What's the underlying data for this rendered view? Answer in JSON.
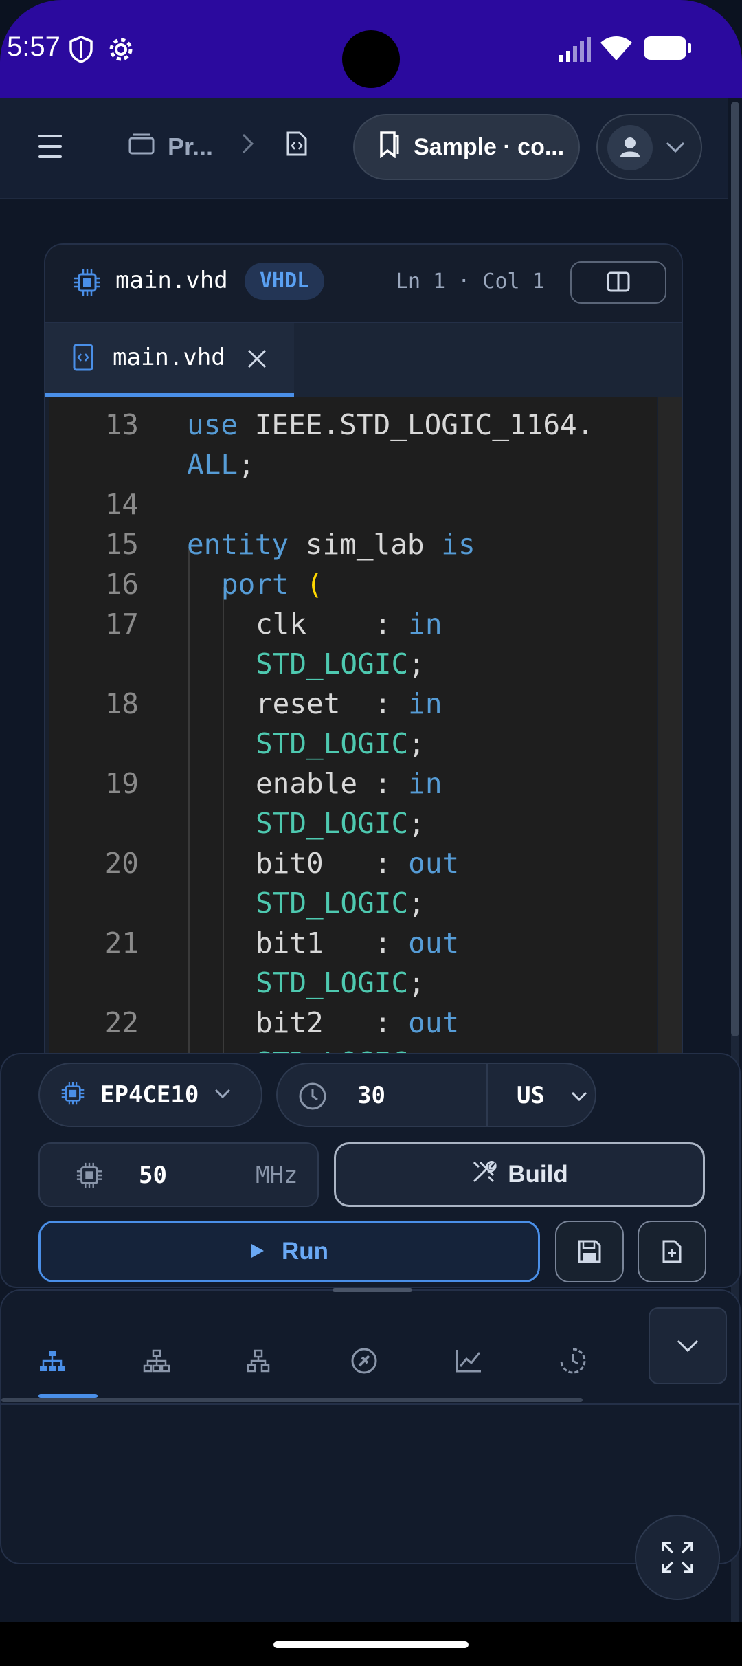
{
  "status_bar": {
    "time": "5:57"
  },
  "app_bar": {
    "breadcrumb_project": "Pr...",
    "sample_label": "Sample · co..."
  },
  "editor": {
    "file_name": "main.vhd",
    "language": "VHDL",
    "cursor": "Ln 1 · Col 1",
    "tab_label": "main.vhd",
    "lines": [
      {
        "n": "13",
        "text": "use IEEE.STD_LOGIC_1164.",
        "cont": "ALL;"
      },
      {
        "n": "14",
        "text": ""
      },
      {
        "n": "15",
        "text": "entity sim_lab is"
      },
      {
        "n": "16",
        "text": "port ("
      },
      {
        "n": "17",
        "text": "clk    : in",
        "cont": "STD_LOGIC;"
      },
      {
        "n": "18",
        "text": "reset  : in",
        "cont": "STD_LOGIC;"
      },
      {
        "n": "19",
        "text": "enable : in",
        "cont": "STD_LOGIC;"
      },
      {
        "n": "20",
        "text": "bit0   : out",
        "cont": "STD_LOGIC;"
      },
      {
        "n": "21",
        "text": "bit1   : out",
        "cont": "STD_LOGIC;"
      },
      {
        "n": "22",
        "text": "bit2   : out",
        "cont": "STD_LOGIC;"
      }
    ]
  },
  "controls": {
    "device": "EP4CE10",
    "sim_time": "30",
    "time_unit": "US",
    "clock_value": "50",
    "clock_unit": "MHz",
    "build_label": "Build",
    "run_label": "Run"
  },
  "colors": {
    "accent": "#4a8fe8",
    "status_bar": "#2b0a9e",
    "keyword": "#569cd6",
    "type": "#4ec9b0"
  }
}
